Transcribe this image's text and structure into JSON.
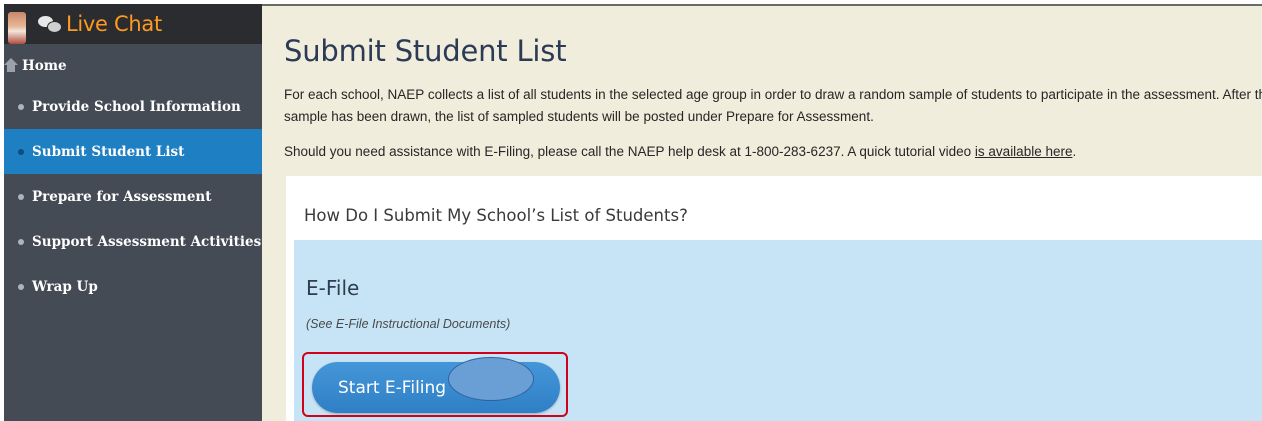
{
  "sidebar": {
    "livechat_label": "Live Chat",
    "items": [
      {
        "label": "Home",
        "icon": "home-icon"
      },
      {
        "label": "Provide School Information"
      },
      {
        "label": "Submit Student List",
        "active": true
      },
      {
        "label": "Prepare for Assessment"
      },
      {
        "label": "Support Assessment Activities"
      },
      {
        "label": "Wrap Up"
      }
    ]
  },
  "main": {
    "title": "Submit Student List",
    "intro": "For each school, NAEP collects a list of all students in the selected age group in order to draw a random sample of students to participate in the assessment. After the sample has been drawn, the list of sampled students will be posted under Prepare for Assessment.",
    "help_text": "Should you need assistance with E-Filing, please call the NAEP help desk at 1-800-283-6237. A quick tutorial video ",
    "help_link": "is available here",
    "help_end": ".",
    "panel_heading": "How Do I Submit My School’s List of Students?",
    "efile": {
      "title": "E-File",
      "docs_note": "(See E-File Instructional Documents)",
      "button_label": "Start E-Filing"
    }
  },
  "colors": {
    "sidebar_bg": "#454b55",
    "active_item": "#1e7fc2",
    "livechat_text": "#ff9a1f",
    "content_bg": "#f1eddc",
    "efile_bg": "#c6e4f6",
    "highlight_border": "#d0021b"
  }
}
